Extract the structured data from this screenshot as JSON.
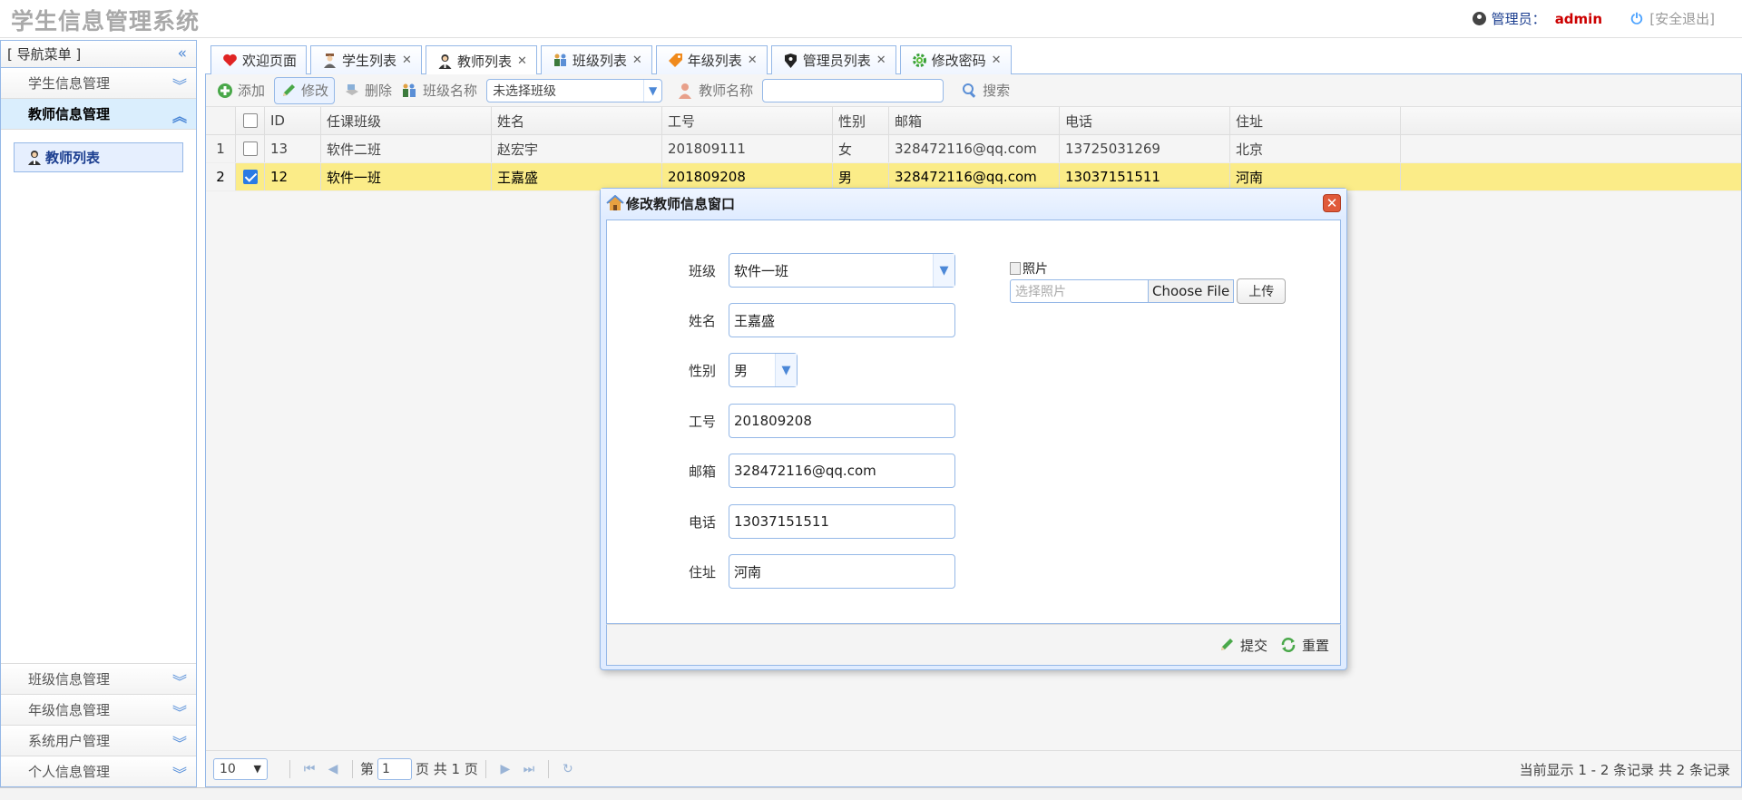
{
  "header": {
    "app_title": "学生信息管理系统",
    "admin_label": "管理员：",
    "admin_name": "admin",
    "logout": "[安全退出]"
  },
  "sidebar": {
    "title": "[ 导航菜单 ]",
    "sections": [
      {
        "label": "学生信息管理",
        "expanded": false
      },
      {
        "label": "教师信息管理",
        "expanded": true
      }
    ],
    "active_link": "教师列表",
    "bottom_sections": [
      {
        "label": "班级信息管理"
      },
      {
        "label": "年级信息管理"
      },
      {
        "label": "系统用户管理"
      },
      {
        "label": "个人信息管理"
      }
    ]
  },
  "tabs": [
    {
      "label": "欢迎页面",
      "closable": false,
      "icon": "heart-icon"
    },
    {
      "label": "学生列表",
      "closable": true,
      "icon": "student-icon"
    },
    {
      "label": "教师列表",
      "closable": true,
      "icon": "teacher-icon",
      "active": true
    },
    {
      "label": "班级列表",
      "closable": true,
      "icon": "class-icon"
    },
    {
      "label": "年级列表",
      "closable": true,
      "icon": "tag-icon"
    },
    {
      "label": "管理员列表",
      "closable": true,
      "icon": "admin-icon"
    },
    {
      "label": "修改密码",
      "closable": true,
      "icon": "gear-icon"
    }
  ],
  "toolbar": {
    "add": "添加",
    "edit": "修改",
    "delete": "删除",
    "class_name_label": "班级名称",
    "class_select_value": "未选择班级",
    "teacher_name_label": "教师名称",
    "teacher_name_value": "",
    "search": "搜索"
  },
  "grid": {
    "columns": [
      "ID",
      "任课班级",
      "姓名",
      "工号",
      "性别",
      "邮箱",
      "电话",
      "住址"
    ],
    "rows": [
      {
        "rownum": "1",
        "checked": false,
        "cells": [
          "13",
          "软件二班",
          "赵宏宇",
          "201809111",
          "女",
          "328472116@qq.com",
          "13725031269",
          "北京"
        ]
      },
      {
        "rownum": "2",
        "checked": true,
        "cells": [
          "12",
          "软件一班",
          "王嘉盛",
          "201809208",
          "男",
          "328472116@qq.com",
          "13037151511",
          "河南"
        ]
      }
    ]
  },
  "pager": {
    "page_size": "10",
    "page_prefix": "第",
    "page_value": "1",
    "page_suffix": "页 共 1 页",
    "info": "当前显示 1 - 2 条记录 共 2 条记录"
  },
  "dialog": {
    "title": "修改教师信息窗口",
    "fields": {
      "class_label": "班级",
      "class_value": "软件一班",
      "name_label": "姓名",
      "name_value": "王嘉盛",
      "gender_label": "性别",
      "gender_value": "男",
      "number_label": "工号",
      "number_value": "201809208",
      "email_label": "邮箱",
      "email_value": "328472116@qq.com",
      "phone_label": "电话",
      "phone_value": "13037151511",
      "address_label": "住址",
      "address_value": "河南"
    },
    "photo_alt": "照片",
    "photo_placeholder": "选择照片",
    "choose_file": "Choose File",
    "upload": "上传",
    "submit": "提交",
    "reset": "重置"
  }
}
